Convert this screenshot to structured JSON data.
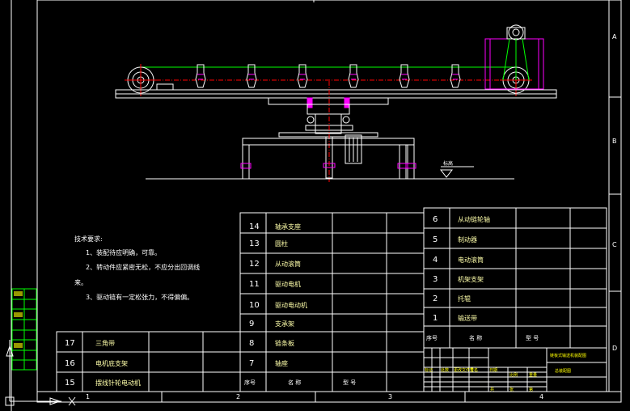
{
  "colors": {
    "background": "#000000",
    "frame": "#ffffff",
    "machine": "#ffffff",
    "chain": "#00ff00",
    "accent": "#ff00ff",
    "centerline": "#ff0000",
    "annotation": "#ffff00",
    "sidebar": "#00ff00"
  },
  "zone_letters": [
    "A",
    "B",
    "C",
    "D"
  ],
  "zone_numbers": [
    "1",
    "2",
    "3",
    "4"
  ],
  "ground_mark": "标高",
  "notes": {
    "title": "技术要求:",
    "lines": [
      "1、装配待应明确，可靠。",
      "2、转动件应紧密无松，不应分出回调线",
      "来。",
      "3、驱动链有一定松张力，不得偏偏。"
    ]
  },
  "bom_middle": {
    "rows": [
      {
        "no": "14",
        "name": "轴承支座"
      },
      {
        "no": "13",
        "name": "圆柱"
      },
      {
        "no": "12",
        "name": "从动滚筒"
      },
      {
        "no": "11",
        "name": "驱动电机"
      },
      {
        "no": "10",
        "name": "驱动电动机"
      },
      {
        "no": "9",
        "name": "支承架"
      },
      {
        "no": "8",
        "name": "链条板"
      },
      {
        "no": "7",
        "name": "轴座"
      }
    ],
    "header": {
      "no": "序号",
      "name": "名 称",
      "spec": "型 号"
    }
  },
  "bom_left": {
    "rows": [
      {
        "no": "17",
        "name": "三角带"
      },
      {
        "no": "16",
        "name": "电机底支架"
      },
      {
        "no": "15",
        "name": "摆线针轮电动机"
      }
    ]
  },
  "bom_right": {
    "rows": [
      {
        "no": "6",
        "name": "从动链轮轴"
      },
      {
        "no": "5",
        "name": "制动器"
      },
      {
        "no": "4",
        "name": "电动滚筒"
      },
      {
        "no": "3",
        "name": "机架支架"
      },
      {
        "no": "2",
        "name": "托辊"
      },
      {
        "no": "1",
        "name": "输送带"
      }
    ],
    "header": {
      "no": "序号",
      "name": "名 称",
      "spec": "型 号"
    }
  },
  "title_block": {
    "line1": "链板式输送机装配图",
    "line2": "总装配图",
    "small_labels": [
      "标记",
      "处数",
      "更改文件号",
      "签名",
      "日期",
      "比例",
      "重量",
      "共",
      "张",
      "第"
    ]
  }
}
